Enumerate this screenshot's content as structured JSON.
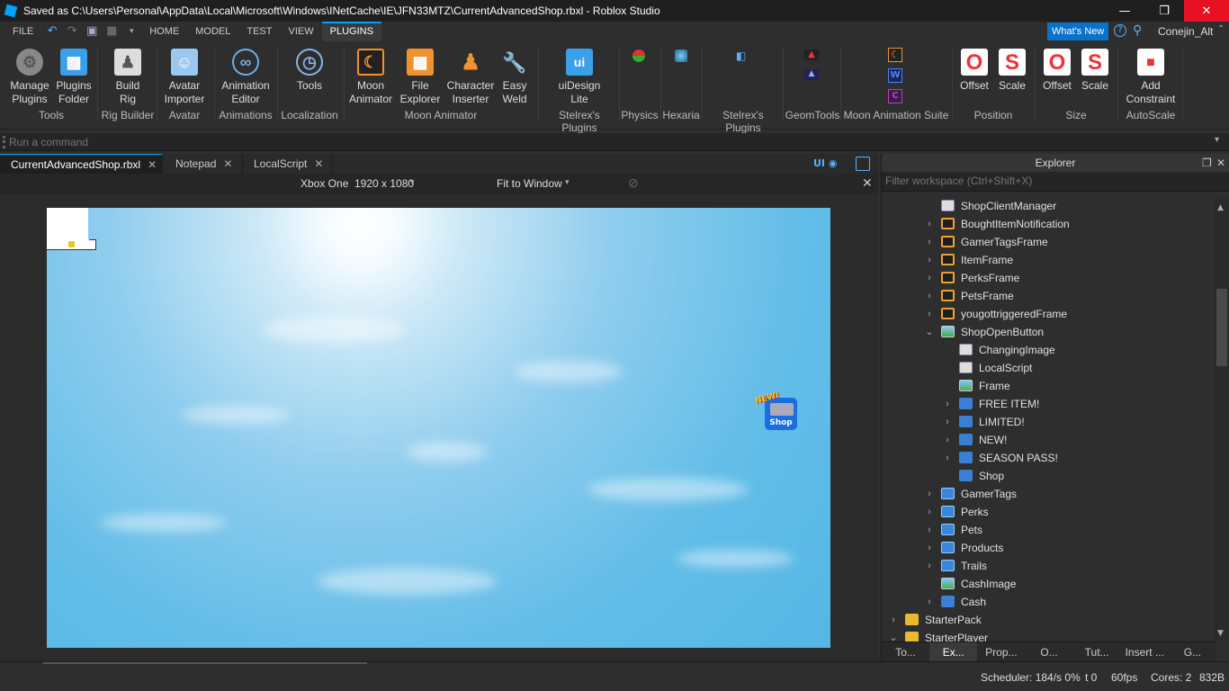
{
  "window": {
    "title": "Saved as C:\\Users\\Personal\\AppData\\Local\\Microsoft\\Windows\\INetCache\\IE\\JFN33MTZ\\CurrentAdvancedShop.rbxl - Roblox Studio"
  },
  "menu": {
    "file": "FILE",
    "tabs": [
      "HOME",
      "MODEL",
      "TEST",
      "VIEW",
      "PLUGINS"
    ],
    "whats_new": "What's New",
    "user": "Conejin_Alt"
  },
  "ribbon": {
    "buttons": [
      {
        "line1": "Manage",
        "line2": "Plugins"
      },
      {
        "line1": "Plugins",
        "line2": "Folder"
      },
      {
        "line1": "Build",
        "line2": "Rig"
      },
      {
        "line1": "Avatar",
        "line2": "Importer"
      },
      {
        "line1": "Animation",
        "line2": "Editor"
      },
      {
        "line1": "Tools",
        "line2": ""
      },
      {
        "line1": "Moon",
        "line2": "Animator"
      },
      {
        "line1": "File",
        "line2": "Explorer"
      },
      {
        "line1": "Character",
        "line2": "Inserter"
      },
      {
        "line1": "Easy",
        "line2": "Weld"
      },
      {
        "line1": "uiDesign",
        "line2": "Lite"
      },
      {
        "line1": "Offset",
        "line2": ""
      },
      {
        "line1": "Scale",
        "line2": ""
      },
      {
        "line1": "Offset",
        "line2": ""
      },
      {
        "line1": "Scale",
        "line2": ""
      },
      {
        "line1": "Add",
        "line2": "Constraint"
      }
    ],
    "groups": [
      "Tools",
      "Rig Builder",
      "Avatar",
      "Animations",
      "Localization",
      "Moon Animator",
      "Stelrex's Plugins",
      "Physics",
      "Hexaria",
      "Stelrex's Plugins",
      "GeomTools",
      "Moon Animation Suite",
      "Position",
      "Size",
      "AutoScale"
    ]
  },
  "command": {
    "placeholder": "Run a command"
  },
  "tabs": [
    {
      "label": "CurrentAdvancedShop.rbxl"
    },
    {
      "label": "Notepad"
    },
    {
      "label": "LocalScript"
    }
  ],
  "device": {
    "name": "Xbox One",
    "resolution": "1920 x 1080",
    "fit": "Fit to Window",
    "ui": "UI"
  },
  "viewport": {
    "shop_label": "Shop",
    "new_label": "NEW!"
  },
  "explorer": {
    "title": "Explorer",
    "filter_placeholder": "Filter workspace (Ctrl+Shift+X)",
    "items": [
      {
        "label": "ShopClientManager",
        "depth": 2,
        "chev": "",
        "icon": "script"
      },
      {
        "label": "BoughtItemNotification",
        "depth": 2,
        "chev": ">",
        "icon": "frame"
      },
      {
        "label": "GamerTagsFrame",
        "depth": 2,
        "chev": ">",
        "icon": "frame"
      },
      {
        "label": "ItemFrame",
        "depth": 2,
        "chev": ">",
        "icon": "frame"
      },
      {
        "label": "PerksFrame",
        "depth": 2,
        "chev": ">",
        "icon": "frame"
      },
      {
        "label": "PetsFrame",
        "depth": 2,
        "chev": ">",
        "icon": "frame"
      },
      {
        "label": "yougottriggeredFrame",
        "depth": 2,
        "chev": ">",
        "icon": "frame"
      },
      {
        "label": "ShopOpenButton",
        "depth": 2,
        "chev": "v",
        "icon": "imagebutton"
      },
      {
        "label": "ChangingImage",
        "depth": 3,
        "chev": "",
        "icon": "script"
      },
      {
        "label": "LocalScript",
        "depth": 3,
        "chev": "",
        "icon": "script"
      },
      {
        "label": "Frame",
        "depth": 3,
        "chev": "",
        "icon": "image"
      },
      {
        "label": "FREE ITEM!",
        "depth": 3,
        "chev": ">",
        "icon": "text"
      },
      {
        "label": "LIMITED!",
        "depth": 3,
        "chev": ">",
        "icon": "text"
      },
      {
        "label": "NEW!",
        "depth": 3,
        "chev": ">",
        "icon": "text"
      },
      {
        "label": "SEASON PASS!",
        "depth": 3,
        "chev": ">",
        "icon": "text"
      },
      {
        "label": "Shop",
        "depth": 3,
        "chev": "",
        "icon": "text"
      },
      {
        "label": "GamerTags",
        "depth": 2,
        "chev": ">",
        "icon": "folder"
      },
      {
        "label": "Perks",
        "depth": 2,
        "chev": ">",
        "icon": "folder"
      },
      {
        "label": "Pets",
        "depth": 2,
        "chev": ">",
        "icon": "folder"
      },
      {
        "label": "Products",
        "depth": 2,
        "chev": ">",
        "icon": "folder"
      },
      {
        "label": "Trails",
        "depth": 2,
        "chev": ">",
        "icon": "folder"
      },
      {
        "label": "CashImage",
        "depth": 2,
        "chev": "",
        "icon": "image"
      },
      {
        "label": "Cash",
        "depth": 2,
        "chev": ">",
        "icon": "text"
      },
      {
        "label": "StarterPack",
        "depth": 0,
        "chev": ">",
        "icon": "pack"
      },
      {
        "label": "StarterPlayer",
        "depth": 0,
        "chev": "v",
        "icon": "pack"
      }
    ],
    "bottom_tabs": [
      "To...",
      "Ex...",
      "Prop...",
      "O...",
      "Tut...",
      "Insert ...",
      "G..."
    ]
  },
  "status": {
    "scheduler": "Scheduler: 184/s 0%",
    "t": "t 0",
    "fps": "60fps",
    "cores": "Cores: 2",
    "mem": "832B"
  },
  "colors": {
    "accent": "#00a2ff",
    "orange": "#f0922e"
  }
}
